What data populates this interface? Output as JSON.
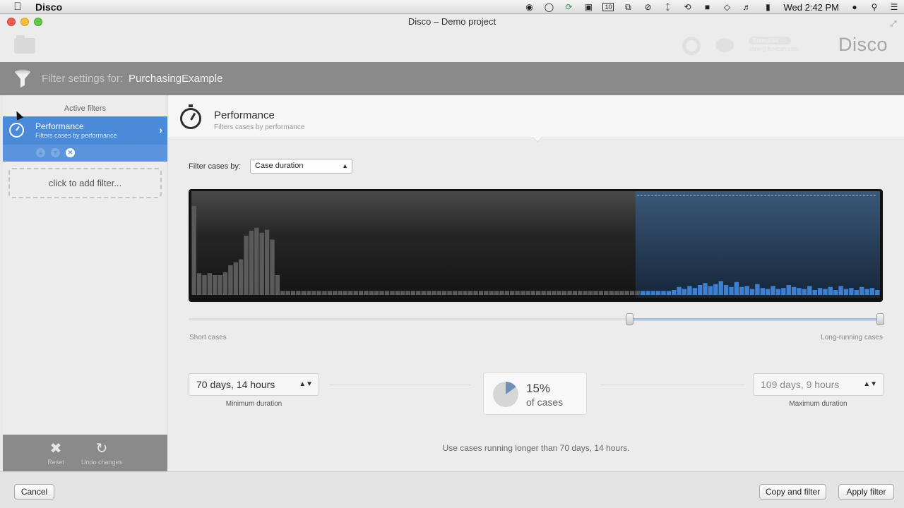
{
  "menubar": {
    "app_name": "Disco",
    "clock": "Wed 2:42 PM",
    "icons": [
      "apple-icon",
      "disk-icon",
      "shield-icon",
      "sync-icon",
      "clipboard-icon",
      "calendar-icon",
      "window-icon",
      "minus-circle-icon",
      "bluetooth-icon",
      "time-machine-icon",
      "lock-icon",
      "wifi-icon",
      "volume-icon",
      "battery-icon",
      "user-icon",
      "spotlight-icon",
      "list-icon"
    ],
    "calendar_day": "10"
  },
  "window": {
    "title": "Disco – Demo project"
  },
  "toolbar": {
    "brand": "Disco",
    "user_pill": "Enterprise",
    "user_mail": "anne@fluxicon.com"
  },
  "filter_header": {
    "label": "Filter settings for:",
    "project": "PurchasingExample"
  },
  "sidebar": {
    "heading": "Active filters",
    "active_filter": {
      "title": "Performance",
      "subtitle": "Filters cases by performance"
    },
    "add_filter": "click to add filter...",
    "footer": {
      "reset": "Reset",
      "undo": "Undo changes"
    }
  },
  "main": {
    "title": "Performance",
    "subtitle": "Filters cases by performance",
    "filter_by_label": "Filter cases by:",
    "filter_by_value": "Case duration",
    "short_label": "Short cases",
    "long_label": "Long-running cases",
    "min_duration": "70 days, 14 hours",
    "min_label": "Minimum duration",
    "max_duration": "109 days, 9 hours",
    "max_label": "Maximum duration",
    "percent": "15%",
    "percent_sub": "of cases",
    "percent_value": 15,
    "summary": "Use cases running longer than 70 days, 14 hours."
  },
  "histogram": {
    "selection_start_fraction": 0.645,
    "bars": [
      0.9,
      0.22,
      0.2,
      0.22,
      0.2,
      0.2,
      0.23,
      0.3,
      0.33,
      0.36,
      0.6,
      0.65,
      0.68,
      0.63,
      0.66,
      0.56,
      0.2,
      0.04,
      0.04,
      0.04,
      0.04,
      0.04,
      0.04,
      0.04,
      0.04,
      0.04,
      0.04,
      0.04,
      0.04,
      0.04,
      0.04,
      0.04,
      0.04,
      0.04,
      0.04,
      0.04,
      0.04,
      0.04,
      0.04,
      0.04,
      0.04,
      0.04,
      0.04,
      0.04,
      0.04,
      0.04,
      0.04,
      0.04,
      0.04,
      0.04,
      0.04,
      0.04,
      0.04,
      0.04,
      0.04,
      0.04,
      0.04,
      0.04,
      0.04,
      0.04,
      0.04,
      0.04,
      0.04,
      0.04,
      0.04,
      0.04,
      0.04,
      0.04,
      0.04,
      0.04,
      0.04,
      0.04,
      0.04,
      0.04,
      0.04,
      0.04,
      0.04,
      0.04,
      0.04,
      0.04,
      0.04,
      0.04,
      0.04,
      0.04,
      0.04,
      0.04,
      0.04,
      0.04,
      0.04,
      0.04,
      0.04,
      0.04,
      0.05,
      0.08,
      0.06,
      0.09,
      0.07,
      0.1,
      0.12,
      0.09,
      0.11,
      0.14,
      0.1,
      0.08,
      0.13,
      0.08,
      0.09,
      0.06,
      0.11,
      0.07,
      0.06,
      0.09,
      0.06,
      0.07,
      0.1,
      0.08,
      0.07,
      0.06,
      0.09,
      0.05,
      0.07,
      0.06,
      0.08,
      0.05,
      0.09,
      0.06,
      0.07,
      0.05,
      0.08,
      0.06,
      0.07,
      0.05
    ],
    "colors": {
      "bar": "#5a5a5a",
      "selected_bar": "#3f7fd0",
      "selection_bg": "#1e3550"
    }
  },
  "bottom": {
    "cancel": "Cancel",
    "copy_filter": "Copy and filter",
    "apply_filter": "Apply filter"
  }
}
